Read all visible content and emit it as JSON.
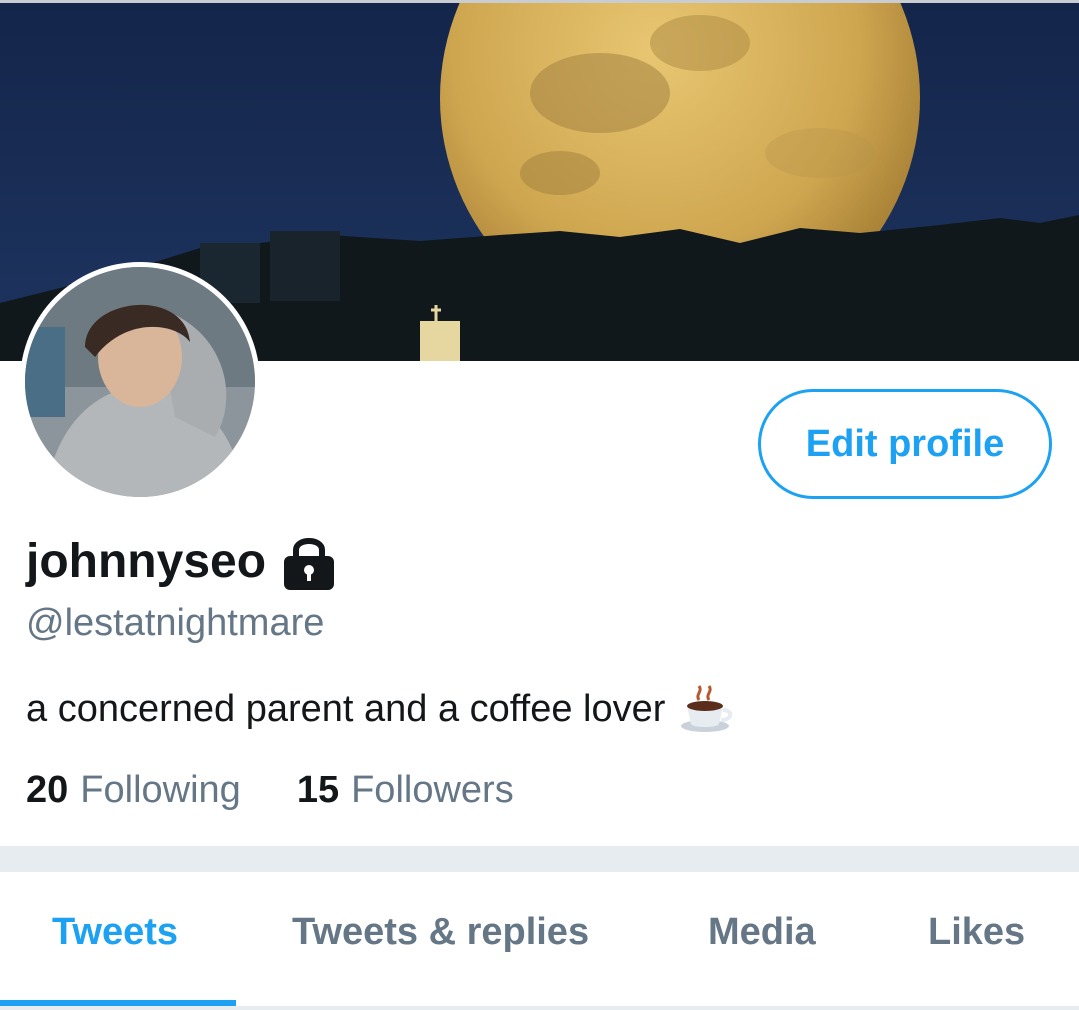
{
  "profile": {
    "display_name": "johnnyseo",
    "handle": "@lestatnightmare",
    "bio": "a concerned parent and a coffee lover",
    "protected_icon": "lock-icon",
    "bio_emoji": "coffee-cup-icon"
  },
  "actions": {
    "edit_profile_label": "Edit profile"
  },
  "stats": {
    "following_count": "20",
    "following_label": "Following",
    "followers_count": "15",
    "followers_label": "Followers"
  },
  "tabs": [
    {
      "label": "Tweets",
      "active": true
    },
    {
      "label": "Tweets & replies",
      "active": false
    },
    {
      "label": "Media",
      "active": false
    },
    {
      "label": "Likes",
      "active": false
    }
  ],
  "colors": {
    "accent": "#1da1f2",
    "text_primary": "#14171a",
    "text_secondary": "#657786",
    "divider": "#e6ecf0"
  }
}
